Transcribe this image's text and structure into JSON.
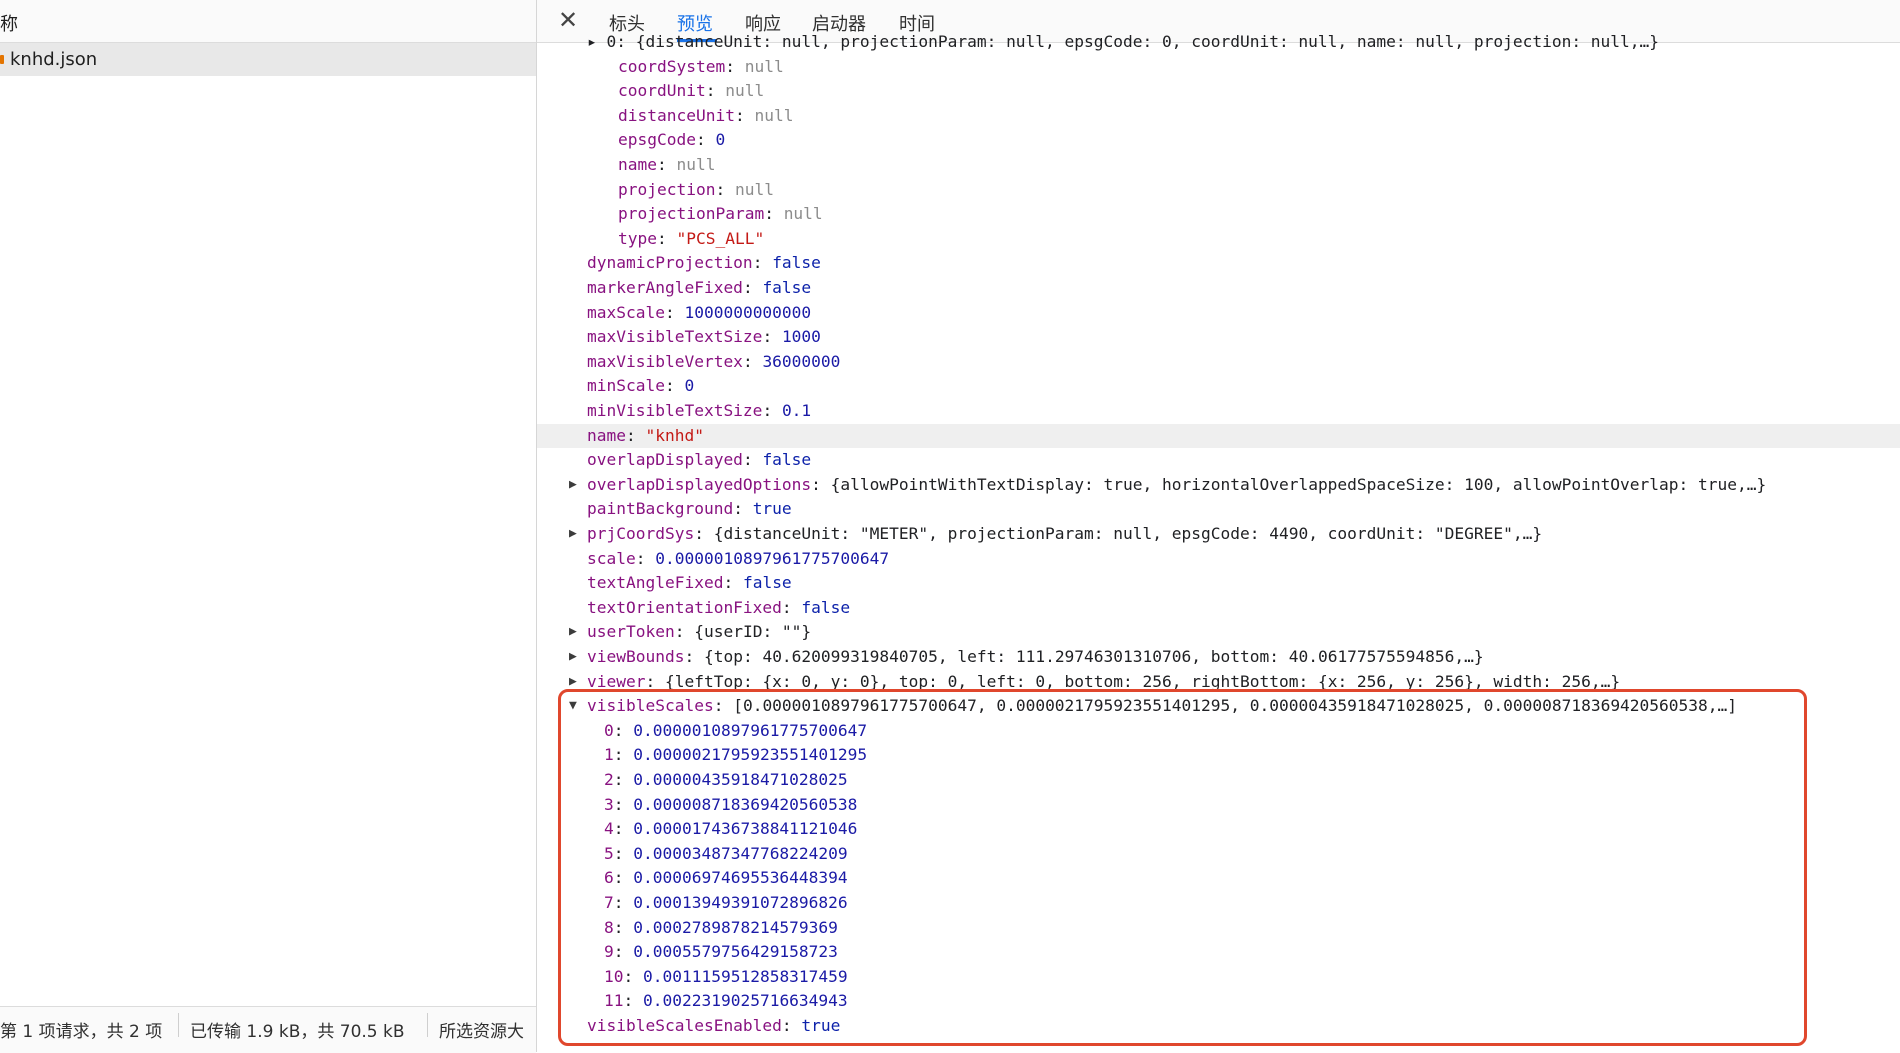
{
  "left_panel": {
    "header": "称",
    "file_name": "knhd.json",
    "footer": [
      "第 1 项请求，共 2 项",
      "已传输 1.9 kB，共 70.5 kB",
      "所选资源大"
    ]
  },
  "tabs": [
    "标头",
    "预览",
    "响应",
    "启动器",
    "时间"
  ],
  "active_tab": "预览",
  "close_label": "✕",
  "top_cut_line": "▸ 0: {distanceUnit: null, projectionParam: null, epsgCode: 0, coordUnit: null, name: null, projection: null,…}",
  "inner_props": [
    {
      "key": "coordSystem",
      "value": "null",
      "type": "null"
    },
    {
      "key": "coordUnit",
      "value": "null",
      "type": "null"
    },
    {
      "key": "distanceUnit",
      "value": "null",
      "type": "null"
    },
    {
      "key": "epsgCode",
      "value": "0",
      "type": "num"
    },
    {
      "key": "name",
      "value": "null",
      "type": "null"
    },
    {
      "key": "projection",
      "value": "null",
      "type": "null"
    },
    {
      "key": "projectionParam",
      "value": "null",
      "type": "null"
    },
    {
      "key": "type",
      "value": "\"PCS_ALL\"",
      "type": "str"
    }
  ],
  "props": [
    {
      "key": "dynamicProjection",
      "value": "false",
      "type": "kw"
    },
    {
      "key": "markerAngleFixed",
      "value": "false",
      "type": "kw"
    },
    {
      "key": "maxScale",
      "value": "1000000000000",
      "type": "num"
    },
    {
      "key": "maxVisibleTextSize",
      "value": "1000",
      "type": "num"
    },
    {
      "key": "maxVisibleVertex",
      "value": "36000000",
      "type": "num"
    },
    {
      "key": "minScale",
      "value": "0",
      "type": "num"
    },
    {
      "key": "minVisibleTextSize",
      "value": "0.1",
      "type": "num"
    },
    {
      "key": "name",
      "value": "\"knhd\"",
      "type": "str"
    },
    {
      "key": "overlapDisplayed",
      "value": "false",
      "type": "kw"
    },
    {
      "key": "overlapDisplayedOptions",
      "value": "{allowPointWithTextDisplay: true, horizontalOverlappedSpaceSize: 100, allowPointOverlap: true,…}",
      "type": "obj"
    },
    {
      "key": "paintBackground",
      "value": "true",
      "type": "kw"
    },
    {
      "key": "prjCoordSys",
      "value": "{distanceUnit: \"METER\", projectionParam: null, epsgCode: 4490, coordUnit: \"DEGREE\",…}",
      "type": "obj"
    },
    {
      "key": "scale",
      "value": "0.000001089796177570064​7",
      "type": "num"
    },
    {
      "key": "textAngleFixed",
      "value": "false",
      "type": "kw"
    },
    {
      "key": "textOrientationFixed",
      "value": "false",
      "type": "kw"
    },
    {
      "key": "userToken",
      "value": "{userID: \"\"}",
      "type": "obj"
    },
    {
      "key": "viewBounds",
      "value": "{top: 40.620099319840705, left: 111.29746301310706, bottom: 40.06177575594856,…}",
      "type": "obj"
    },
    {
      "key": "viewer",
      "value": "{leftTop: {x: 0, y: 0}, top: 0, left: 0, bottom: 256, rightBottom: {x: 256, y: 256}, width: 256,…}",
      "type": "obj"
    }
  ],
  "visible_scales": {
    "key": "visibleScales",
    "summary": "[0.0000010897961775700647, 0.0000021795923551401295, 0.00000435918471028025, 0.0000087183694205605​38,…]",
    "items": [
      {
        "index": "0",
        "value": "0.0000010897961775700647"
      },
      {
        "index": "1",
        "value": "0.0000021795923551401295"
      },
      {
        "index": "2",
        "value": "0.00000435918471028025"
      },
      {
        "index": "3",
        "value": "0.0000087183694205605​38"
      },
      {
        "index": "4",
        "value": "0.000017436738841121046"
      },
      {
        "index": "5",
        "value": "0.00003487347768224209"
      },
      {
        "index": "6",
        "value": "0.00006974695536448394"
      },
      {
        "index": "7",
        "value": "0.00013949391072896826"
      },
      {
        "index": "8",
        "value": "0.0002789878214579369"
      },
      {
        "index": "9",
        "value": "0.0005579756429158723"
      },
      {
        "index": "10",
        "value": "0.0011159512858317459"
      },
      {
        "index": "11",
        "value": "0.0022319025716634943"
      }
    ]
  },
  "last_prop": {
    "key": "visibleScalesEnabled",
    "value": "true",
    "type": "kw"
  },
  "colors": {
    "accent": "#1a73e8",
    "highlight_box": "#e0472d",
    "key": "#881280",
    "string": "#c41a16",
    "number": "#1a1aa6",
    "null": "#8c8c8c"
  }
}
